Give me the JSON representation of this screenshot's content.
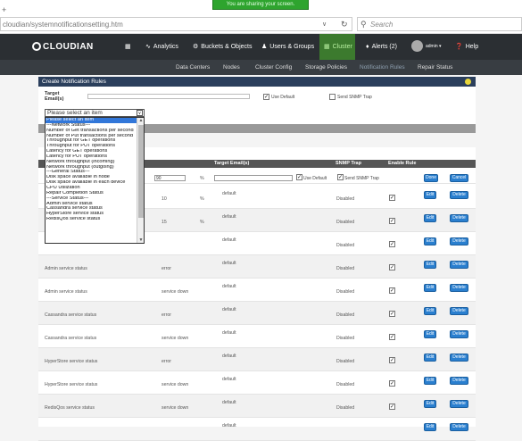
{
  "browser": {
    "share_banner": "You are sharing your screen.",
    "url": "cloudian/systemnotificationsetting.htm",
    "search_placeholder": "Search"
  },
  "nav": {
    "brand": "CLOUDIAN",
    "items": [
      {
        "label": "Analytics"
      },
      {
        "label": "Buckets & Objects"
      },
      {
        "label": "Users & Groups"
      },
      {
        "label": "Cluster"
      },
      {
        "label": "Alerts (2)"
      },
      {
        "label": "admin"
      },
      {
        "label": "Help"
      }
    ]
  },
  "subnav": {
    "items": [
      "Data Centers",
      "Nodes",
      "Cluster Config",
      "Storage Policies",
      "Notification Rules",
      "Repair Status"
    ]
  },
  "panel": {
    "title": "Create Notification Rules",
    "target_label_1": "Target",
    "target_label_2": "Email(s)",
    "use_default": "Use Default",
    "send_snmp": "Send SNMP Trap"
  },
  "dropdown": {
    "selected": "Please select an item",
    "options": [
      "Please select an item",
      "---Network Status---",
      "Number of Get transactions per second",
      "Number of Put transactions per second",
      "Throughput for GET operations",
      "Throughput for PUT operations",
      "Latency for GET operations",
      "Latency for PUT operations",
      "Network throughput (incoming)",
      "Network throughput (outgoing)",
      "---General Status---",
      "Disk space available in node",
      "Disk space available in each device",
      "CPU Utilization",
      "Repair Completion Status",
      "---Service Status---",
      "Admin service status",
      "Cassandra service status",
      "HyperStore service status",
      "RedisQos service status"
    ]
  },
  "table": {
    "headers": {
      "target": "Target Email(s)",
      "snmp": "SNMP Trap",
      "enable": "Enable Rule"
    },
    "edit_row": {
      "value": "90",
      "unit": "%",
      "use_default": "Use Default",
      "send_snmp": "Send SNMP Trap",
      "done": "Done",
      "cancel": "Cancel"
    },
    "rows": [
      {
        "name": "",
        "condition": "10",
        "unit": "%",
        "target": "default",
        "snmp": "Disabled"
      },
      {
        "name": "",
        "condition": "15",
        "unit": "%",
        "target": "default",
        "snmp": "Disabled"
      },
      {
        "name": "",
        "condition": "",
        "unit": "",
        "target": "default",
        "snmp": "Disabled"
      },
      {
        "name": "Admin service status",
        "condition": "error",
        "unit": "",
        "target": "default",
        "snmp": "Disabled"
      },
      {
        "name": "Admin service status",
        "condition": "service down",
        "unit": "",
        "target": "default",
        "snmp": "Disabled"
      },
      {
        "name": "Cassandra service status",
        "condition": "error",
        "unit": "",
        "target": "default",
        "snmp": "Disabled"
      },
      {
        "name": "Cassandra service status",
        "condition": "service down",
        "unit": "",
        "target": "default",
        "snmp": "Disabled"
      },
      {
        "name": "HyperStore service status",
        "condition": "error",
        "unit": "",
        "target": "default",
        "snmp": "Disabled"
      },
      {
        "name": "HyperStore service status",
        "condition": "service down",
        "unit": "",
        "target": "default",
        "snmp": "Disabled"
      },
      {
        "name": "RedisQos service status",
        "condition": "service down",
        "unit": "",
        "target": "default",
        "snmp": "Disabled"
      },
      {
        "name": "",
        "condition": "",
        "unit": "",
        "target": "default",
        "snmp": ""
      }
    ],
    "edit_label": "Edit",
    "delete_label": "Delete"
  }
}
